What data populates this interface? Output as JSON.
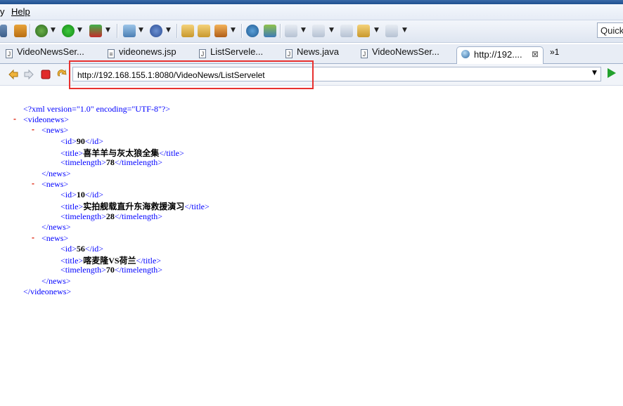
{
  "menubar": {
    "prev_item": "y",
    "help": "Help"
  },
  "toolbar": {
    "quick_access": "Quick"
  },
  "tabs": [
    {
      "label": "VideoNewsSer...",
      "icon": "java-file-icon",
      "active": false
    },
    {
      "label": "videonews.jsp",
      "icon": "jsp-file-icon",
      "active": false
    },
    {
      "label": "ListServele...",
      "icon": "java-file-icon",
      "active": false
    },
    {
      "label": "News.java",
      "icon": "java-file-icon",
      "active": false
    },
    {
      "label": "VideoNewsSer...",
      "icon": "java-file-icon",
      "active": false
    },
    {
      "label": "http://192....",
      "icon": "globe-icon",
      "active": true
    }
  ],
  "tab_overflow": "»1",
  "tab_close": "⊠",
  "browser": {
    "url": "http://192.168.155.1:8080/VideoNews/ListServelet"
  },
  "xml": {
    "declaration": "<?xml version=\"1.0\" encoding=\"UTF-8\"?>",
    "root_open": "<videonews>",
    "root_close": "</videonews>",
    "minus": "-",
    "news_open": "<news>",
    "news_close": "</news>",
    "items": [
      {
        "id": "90",
        "title": "喜羊羊与灰太狼全集",
        "timelength": "78"
      },
      {
        "id": "10",
        "title": "实拍舰载直升东海救援演习",
        "timelength": "28"
      },
      {
        "id": "56",
        "title": "喀麦隆VS荷兰",
        "timelength": "70"
      }
    ],
    "tags": {
      "id_open": "<id>",
      "id_close": "</id>",
      "title_open": "<title>",
      "title_close": "</title>",
      "tl_open": "<timelength>",
      "tl_close": "</timelength>"
    }
  },
  "colors": {
    "highlight": "#e8312f",
    "tag": "#990000",
    "declaration": "#0000ff",
    "minus": "#e0311e"
  }
}
